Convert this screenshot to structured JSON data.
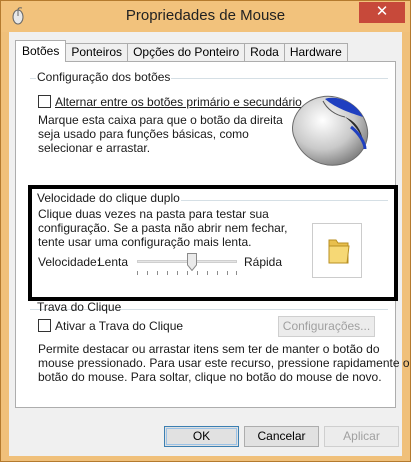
{
  "window": {
    "title": "Propriedades de Mouse",
    "close_glyph": "✕"
  },
  "tabs": [
    {
      "label": "Botões",
      "active": true
    },
    {
      "label": "Ponteiros",
      "active": false
    },
    {
      "label": "Opções do Ponteiro",
      "active": false
    },
    {
      "label": "Roda",
      "active": false
    },
    {
      "label": "Hardware",
      "active": false
    }
  ],
  "button_config": {
    "group_label": "Configuração dos botões",
    "swap_checkbox_label": "Alternar entre os botões primário e secundário",
    "swap_checked": false,
    "description_lines": [
      "Marque esta caixa para que o botão da direita",
      "seja usado para funções básicas, como",
      "selecionar e arrastar."
    ]
  },
  "double_click": {
    "group_label": "Velocidade do clique duplo",
    "description_lines": [
      "Clique duas vezes na pasta para testar sua",
      "configuração. Se a pasta não abrir nem fechar,",
      "tente usar uma configuração mais lenta."
    ],
    "speed_label": "Velocidade:",
    "slow_label": "Lenta",
    "fast_label": "Rápida",
    "slider_level": 0.55
  },
  "click_lock": {
    "group_label": "Trava do Clique",
    "checkbox_label": "Ativar a Trava do Clique",
    "checked": false,
    "settings_button": "Configurações...",
    "description_lines": [
      "Permite destacar ou arrastar itens sem ter de manter o botão do",
      "mouse pressionado. Para usar este recurso, pressione rapidamente o",
      "botão do mouse. Para soltar, clique no botão do mouse de novo."
    ]
  },
  "footer": {
    "ok": "OK",
    "cancel": "Cancelar",
    "apply": "Aplicar"
  },
  "colors": {
    "titlebar": "#f2c27c",
    "close": "#c7493a",
    "highlight_border": "#000000",
    "accent": "#3c7fb1"
  }
}
